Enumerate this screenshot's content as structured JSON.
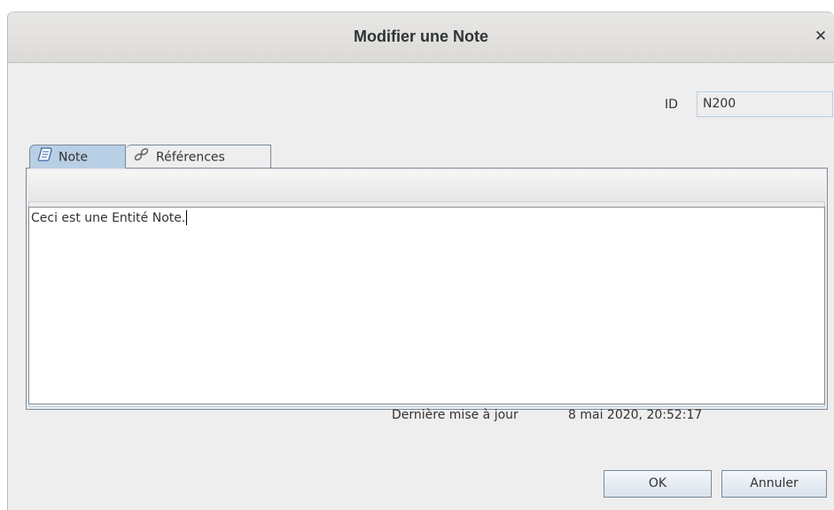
{
  "window": {
    "title": "Modifier une Note"
  },
  "header": {
    "id_label": "ID",
    "id_value": "N200"
  },
  "tabs": [
    {
      "label": "Note",
      "icon": "note-icon",
      "selected": true
    },
    {
      "label": "Références",
      "icon": "link-icon",
      "selected": false
    }
  ],
  "editor": {
    "text": "Ceci est une Entité Note."
  },
  "footer": {
    "last_update_label": "Dernière mise à jour",
    "last_update_value": "8 mai 2020, 20:52:17"
  },
  "buttons": {
    "ok_label": "OK",
    "cancel_label": "Annuler"
  },
  "colors": {
    "selected_tab": "#b8cfe5",
    "window_bg": "#eeeeee",
    "titlebar": "#dcdad7"
  }
}
